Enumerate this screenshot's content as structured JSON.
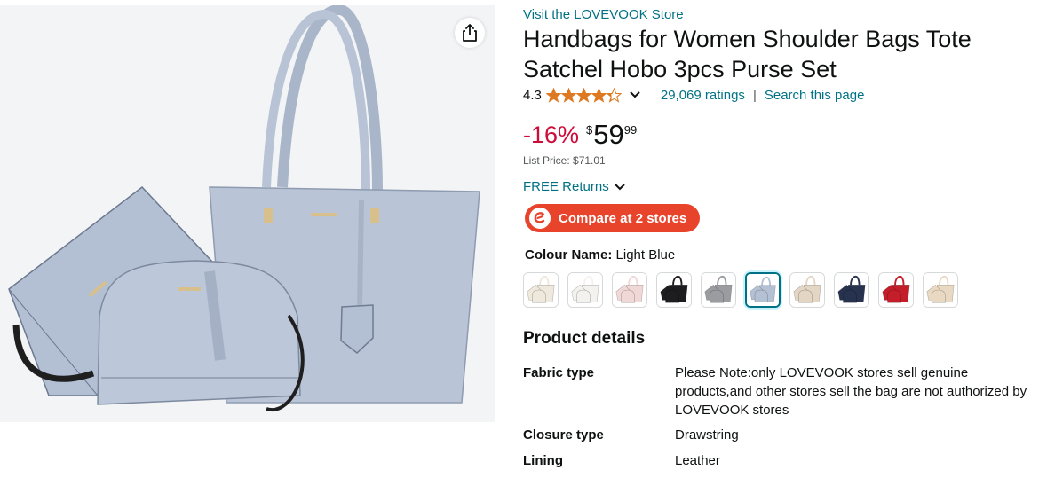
{
  "product": {
    "store_link": "Visit the LOVEVOOK Store",
    "title": "Handbags for Women Shoulder Bags Tote Satchel Hobo 3pcs Purse Set",
    "rating": "4.3",
    "rating_stars": 4.3,
    "ratings_count": "29,069 ratings",
    "separator": "|",
    "search_page": "Search this page"
  },
  "price": {
    "discount": "-16%",
    "currency": "$",
    "whole": "59",
    "fraction": "99",
    "list_label": "List Price:",
    "list_value": "$71.01"
  },
  "returns": {
    "label": "FREE Returns"
  },
  "compare": {
    "label": "Compare at 2 stores",
    "color": "#e8432b"
  },
  "colour": {
    "key": "Colour Name:",
    "value": "Light Blue",
    "swatches": [
      {
        "name": "beige",
        "color": "#efe8dc",
        "selected": false
      },
      {
        "name": "white-black",
        "color": "#f4f2ee",
        "selected": false
      },
      {
        "name": "pink",
        "color": "#efd8d6",
        "selected": false
      },
      {
        "name": "black",
        "color": "#1d1d1f",
        "selected": false
      },
      {
        "name": "grey",
        "color": "#9a9ca0",
        "selected": false
      },
      {
        "name": "light-blue",
        "color": "#b4c0d4",
        "selected": true
      },
      {
        "name": "beige-brown",
        "color": "#e3d6c4",
        "selected": false
      },
      {
        "name": "navy",
        "color": "#27324e",
        "selected": false
      },
      {
        "name": "red",
        "color": "#c41e2a",
        "selected": false
      },
      {
        "name": "cream-brown",
        "color": "#ead9c2",
        "selected": false
      }
    ]
  },
  "details": {
    "heading": "Product details",
    "rows": [
      {
        "key": "Fabric type",
        "value": "Please Note:only LOVEVOOK stores sell genuine products,and other stores sell the bag are not authorized by LOVEVOOK stores"
      },
      {
        "key": "Closure type",
        "value": "Drawstring"
      },
      {
        "key": "Lining",
        "value": "Leather"
      }
    ]
  },
  "icons": {
    "share": "share-icon",
    "star": "star-icon",
    "chevron": "chevron-down-icon",
    "compare_logo": "compare-logo-icon"
  },
  "colors": {
    "link": "#007185",
    "discount": "#cc0c39",
    "star": "#de7921",
    "bag": "#b4c0d4"
  }
}
